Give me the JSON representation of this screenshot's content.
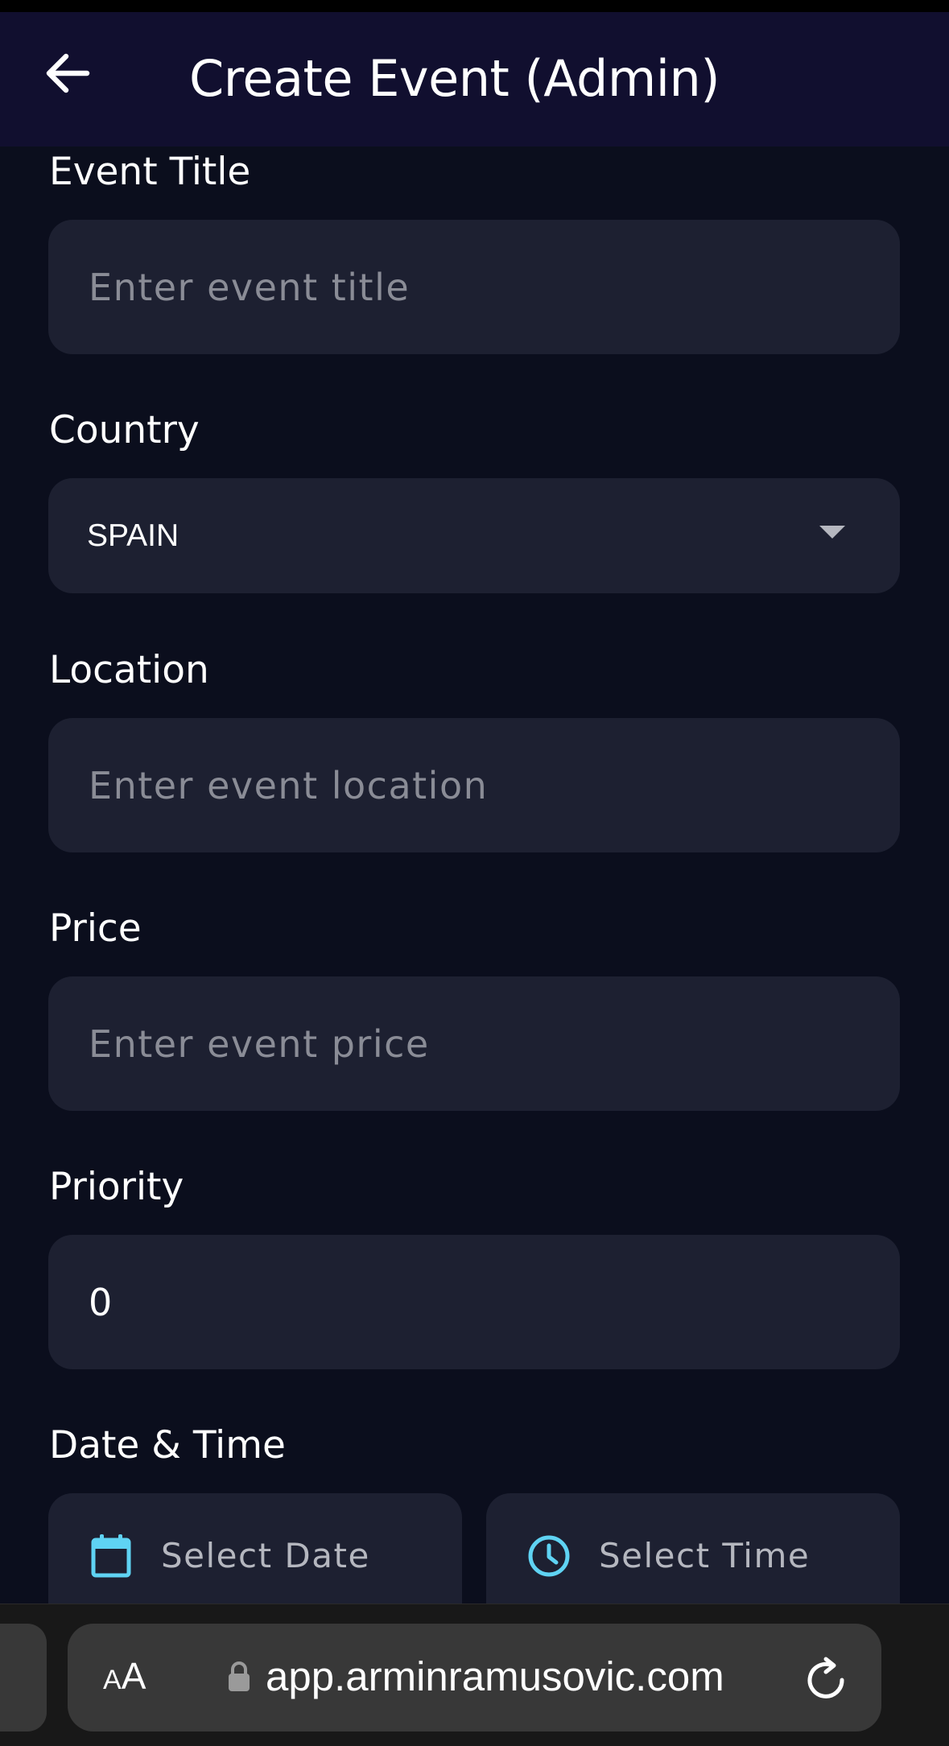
{
  "header": {
    "title": "Create Event (Admin)",
    "back_icon": "arrow-left-icon"
  },
  "form": {
    "event_title": {
      "label": "Event Title",
      "value": "",
      "placeholder": "Enter event title"
    },
    "country": {
      "label": "Country",
      "selected": "SPAIN",
      "icon": "dropdown-arrow-icon"
    },
    "location": {
      "label": "Location",
      "value": "",
      "placeholder": "Enter event location"
    },
    "price": {
      "label": "Price",
      "value": "",
      "placeholder": "Enter event price"
    },
    "priority": {
      "label": "Priority",
      "value": "0"
    },
    "date_time": {
      "label": "Date & Time",
      "date_label": "Select Date",
      "date_icon": "calendar-icon",
      "time_label": "Select Time",
      "time_icon": "clock-icon"
    }
  },
  "browser": {
    "text_size_small": "A",
    "text_size_large": "A",
    "url": "app.arminramusovic.com",
    "lock_icon": "lock-icon",
    "reload_icon": "reload-icon"
  },
  "colors": {
    "header_bg": "#110f2f",
    "page_bg": "#0b0e1d",
    "field_bg": "#1d2031",
    "placeholder": "#8a8c96",
    "accent_icon": "#5fd3f3",
    "browser_bg": "#181818"
  }
}
